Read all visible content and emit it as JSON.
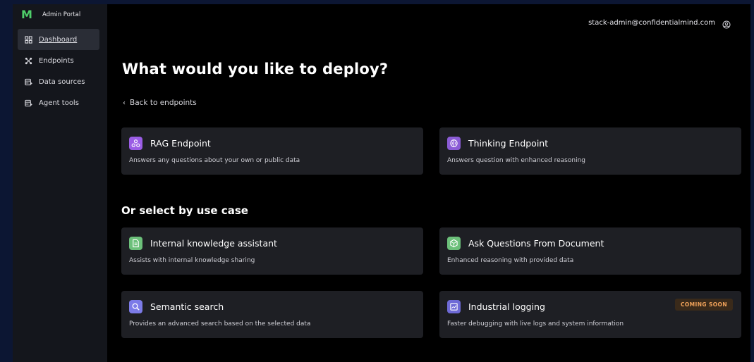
{
  "brand": {
    "name": "Admin Portal",
    "logo_letter": "M"
  },
  "sidebar": {
    "items": [
      {
        "label": "Dashboard",
        "icon": "grid-icon",
        "active": true
      },
      {
        "label": "Endpoints",
        "icon": "endpoints-icon",
        "active": false
      },
      {
        "label": "Data sources",
        "icon": "database-icon",
        "active": false
      },
      {
        "label": "Agent tools",
        "icon": "tools-icon",
        "active": false
      }
    ]
  },
  "header": {
    "user_email": "stack-admin@confidentialmind.com",
    "user_icon": "user-circle-icon"
  },
  "main": {
    "title": "What would you like to deploy?",
    "back_label": "Back to endpoints",
    "use_case_heading": "Or select by use case",
    "endpoints": [
      {
        "title": "RAG Endpoint",
        "desc": "Answers any questions about your own or public data",
        "icon": "rag-icon",
        "icon_color": "#9b5de5"
      },
      {
        "title": "Thinking Endpoint",
        "desc": "Answers question with enhanced reasoning",
        "icon": "brain-icon",
        "icon_color": "#8b5cd6"
      }
    ],
    "use_cases": [
      {
        "title": "Internal knowledge assistant",
        "desc": "Assists with internal knowledge sharing",
        "icon": "document-icon",
        "icon_color": "#6cc07a"
      },
      {
        "title": "Ask Questions From Document",
        "desc": "Enhanced reasoning with provided data",
        "icon": "cube-icon",
        "icon_color": "#6cc07a"
      },
      {
        "title": "Semantic search",
        "desc": "Provides an advanced search based on the selected data",
        "icon": "search-icon",
        "icon_color": "#7c7be8"
      },
      {
        "title": "Industrial logging",
        "desc": "Faster debugging with live logs and system information",
        "icon": "chart-icon",
        "icon_color": "#6e6ad6",
        "badge": "COMING SOON"
      }
    ]
  },
  "colors": {
    "accent": "#4fcf6b",
    "badge_text": "#f0a25a",
    "badge_bg": "#3a2a1a",
    "card_bg": "#1e1f24"
  }
}
